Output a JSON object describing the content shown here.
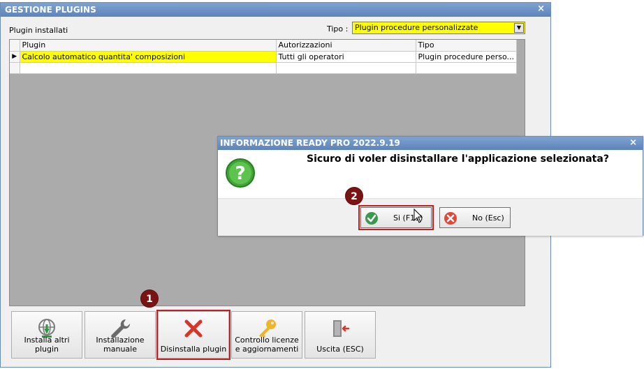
{
  "window": {
    "title": "GESTIONE PLUGINS",
    "close_glyph": "×"
  },
  "header": {
    "installed_label": "Plugin installati",
    "type_label": "Tipo :",
    "type_value": "Plugin procedure personalizzate"
  },
  "grid": {
    "columns": [
      "Plugin",
      "Autorizzazioni",
      "Tipo"
    ],
    "rows": [
      {
        "indicator": "▶",
        "plugin": "Calcolo automatico quantita' composizioni",
        "auth": "Tutti gli operatori",
        "type": "Plugin procedure perso..."
      }
    ]
  },
  "toolbar": {
    "install_more": "Installa altri plugin",
    "manual_install": "Installazione manuale",
    "uninstall": "Disinstalla plugin",
    "license_check": "Controllo licenze e aggiornamenti",
    "exit": "Uscita (ESC)"
  },
  "badges": {
    "one": "1",
    "two": "2"
  },
  "dialog": {
    "title": "INFORMAZIONE READY PRO 2022.9.19",
    "close_glyph": "×",
    "message": "Sicuro di voler disinstallare l'applicazione selezionata?",
    "yes_label": "Si (F11)",
    "no_label": "No (Esc)"
  },
  "colors": {
    "highlight": "#ffff00",
    "annotation": "#c0201f",
    "badge": "#7a1313",
    "titlebar": "#5c84bb"
  },
  "icons": {
    "install_more": "globe-download-icon",
    "manual_install": "wrench-icon",
    "uninstall": "red-x-icon",
    "license_check": "key-icon",
    "exit": "exit-door-icon",
    "dialog": "question-icon",
    "yes": "check-icon",
    "no": "cancel-icon"
  }
}
